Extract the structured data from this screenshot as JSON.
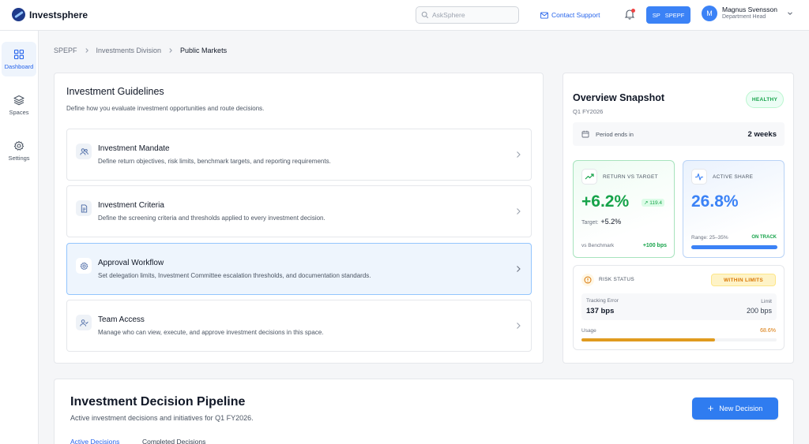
{
  "app": {
    "name": "Investsphere"
  },
  "header": {
    "search_placeholder": "AskSphere",
    "contact_label": "Contact Support",
    "space_initials": "SP",
    "space_name": "SPEPF",
    "user_initial": "M",
    "user_name": "Magnus Svensson",
    "user_role": "Department Head"
  },
  "sidebar": {
    "items": [
      {
        "label": "Dashboard",
        "icon": "grid-icon",
        "active": true
      },
      {
        "label": "Spaces",
        "icon": "layers-icon",
        "active": false
      },
      {
        "label": "Settings",
        "icon": "gear-icon",
        "active": false
      }
    ]
  },
  "breadcrumb": [
    "SPEPF",
    "Investments Division",
    "Public Markets"
  ],
  "guidelines": {
    "title": "Investment Guidelines",
    "subtitle": "Define how you evaluate investment opportunities and route decisions.",
    "items": [
      {
        "title": "Investment Mandate",
        "desc": "Define return objectives, risk limits, benchmark targets, and reporting requirements.",
        "icon": "users-icon",
        "selected": false
      },
      {
        "title": "Investment Criteria",
        "desc": "Define the screening criteria and thresholds applied to every investment decision.",
        "icon": "document-icon",
        "selected": false
      },
      {
        "title": "Approval Workflow",
        "desc": "Set delegation limits, Investment Committee escalation thresholds, and documentation standards.",
        "icon": "gear-icon",
        "selected": true
      },
      {
        "title": "Team Access",
        "desc": "Manage who can view, execute, and approve investment decisions in this space.",
        "icon": "user-check-icon",
        "selected": false
      }
    ]
  },
  "overview": {
    "title": "Overview Snapshot",
    "period": "Q1 FY2026",
    "status": "HEALTHY",
    "period_label": "Period ends in",
    "period_value": "2 weeks",
    "return": {
      "label": "RETURN VS TARGET",
      "value": "+6.2%",
      "delta": "↗ 119.4",
      "target_label": "Target:",
      "target_value": "+5.2%",
      "benchmark_label": "vs Benchmark",
      "benchmark_value": "+100 bps"
    },
    "active_share": {
      "label": "ACTIVE SHARE",
      "value": "26.8%",
      "range": "Range: 25–35%",
      "status": "ON TRACK",
      "fill_fraction": 1.0
    },
    "risk": {
      "label": "RISK STATUS",
      "badge": "WITHIN LIMITS",
      "metric_label": "Tracking Error",
      "metric_value": "137 bps",
      "limit_label": "Limit",
      "limit_value": "200 bps",
      "usage_label": "Usage",
      "usage_value": "68.6%",
      "usage_fraction": 0.686
    }
  },
  "pipeline": {
    "title": "Investment Decision Pipeline",
    "subtitle": "Active investment decisions and initiatives for Q1 FY2026.",
    "new_button": "New Decision",
    "tabs": [
      "Active Decisions",
      "Completed Decisions"
    ]
  },
  "colors": {
    "accent": "#2563eb",
    "success": "#16a34a",
    "warning": "#d97706"
  }
}
